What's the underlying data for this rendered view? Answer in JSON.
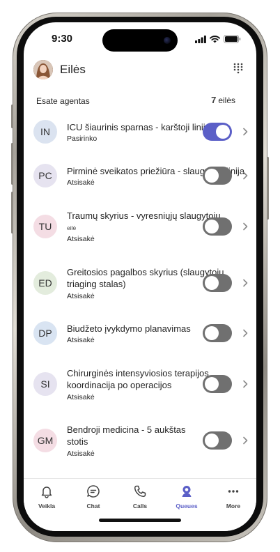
{
  "status_bar": {
    "time": "9:30"
  },
  "header": {
    "title": "Eilės"
  },
  "subheader": {
    "left": "Esate agentas",
    "count": "7",
    "count_label": "eilės"
  },
  "queues": [
    {
      "initials": "IN",
      "avatar_color": "#dbe3f0",
      "title": "ICU šiaurinis sparnas - karštoji linija",
      "status": "Pasirinko",
      "toggle_on": true
    },
    {
      "initials": "PC",
      "avatar_color": "#e6e3f0",
      "title": "Pirminė sveikatos priežiūra - slaugytojų linija",
      "status": "Atsisakė",
      "toggle_on": false
    },
    {
      "initials": "TU",
      "avatar_color": "#f4dde4",
      "title": "Traumų skyrius - vyresniųjų slaugytojų",
      "subtitle": "eilė",
      "status": "Atsisakė",
      "toggle_on": false
    },
    {
      "initials": "ED",
      "avatar_color": "#e3ecdd",
      "title": "Greitosios pagalbos skyrius (slaugytojų triaging stalas)",
      "status": "Atsisakė",
      "toggle_on": false
    },
    {
      "initials": "DP",
      "avatar_color": "#d9e4f2",
      "title": "Biudžeto įvykdymo planavimas",
      "status": "Atsisakė",
      "toggle_on": false
    },
    {
      "initials": "SI",
      "avatar_color": "#e6e3f0",
      "title": "Chirurginės intensyviosios terapijos koordinacija po operacijos",
      "status": "Atsisakė",
      "toggle_on": false
    },
    {
      "initials": "GM",
      "avatar_color": "#f4dde4",
      "title": "Bendroji medicina - 5 aukštas stotis",
      "status": "Atsisakė",
      "toggle_on": false
    }
  ],
  "tabs": [
    {
      "label": "Veikla",
      "icon": "bell-icon"
    },
    {
      "label": "Chat",
      "icon": "chat-icon"
    },
    {
      "label": "Calls",
      "icon": "phone-icon"
    },
    {
      "label": "Queues",
      "icon": "queues-icon",
      "active": true
    },
    {
      "label": "More",
      "icon": "more-icon"
    }
  ],
  "colors": {
    "accent": "#5b5fc7",
    "toggle_off": "#707070"
  }
}
